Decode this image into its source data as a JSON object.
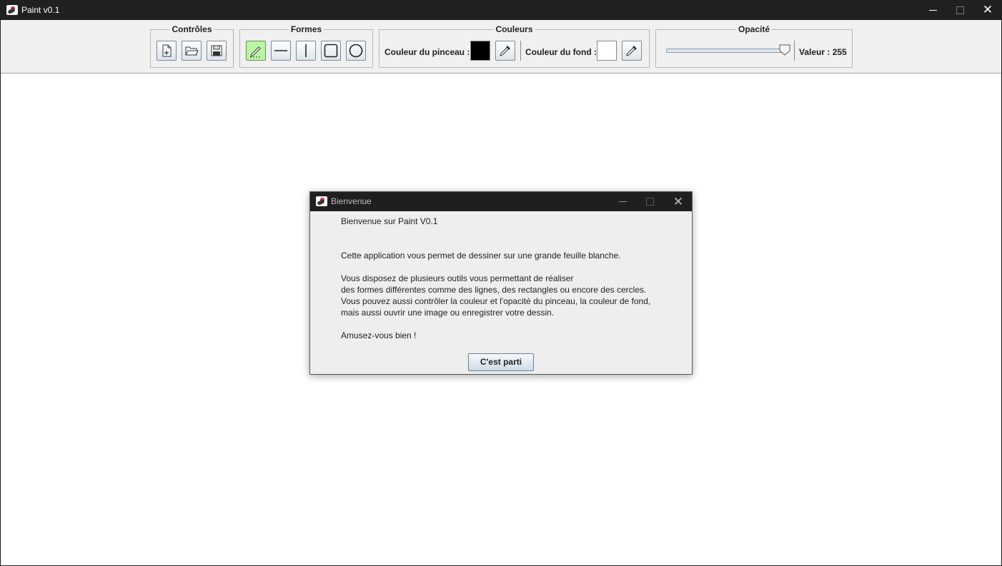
{
  "window": {
    "title": "Paint v0.1",
    "icon": "paint-app-icon",
    "controls": {
      "minimize": "minimize-icon",
      "maximize": "maximize-icon",
      "close": "✕"
    }
  },
  "toolbar": {
    "controles": {
      "legend": "Contrôles",
      "buttons": [
        {
          "name": "new-document",
          "icon": "new-document-icon"
        },
        {
          "name": "open-folder",
          "icon": "open-folder-icon"
        },
        {
          "name": "save",
          "icon": "save-icon"
        }
      ]
    },
    "formes": {
      "legend": "Formes",
      "selected": "pencil",
      "buttons": [
        {
          "name": "pencil",
          "icon": "pencil-icon",
          "active": true
        },
        {
          "name": "horizontal-line",
          "icon": "horizontal-line-icon"
        },
        {
          "name": "vertical-line",
          "icon": "vertical-line-icon"
        },
        {
          "name": "rectangle",
          "icon": "rectangle-icon"
        },
        {
          "name": "circle",
          "icon": "circle-icon"
        }
      ]
    },
    "couleurs": {
      "legend": "Couleurs",
      "brush_label": "Couleur du pinceau :",
      "brush_color": "#000000",
      "background_label": "Couleur du fond :",
      "background_color": "#ffffff",
      "picker_icon": "eyedropper-icon",
      "active_tool_color": "#b9f5a3"
    },
    "opacite": {
      "legend": "Opacité",
      "value_label": "Valeur : 255",
      "slider_value": 255,
      "slider_max": 255
    }
  },
  "dialog": {
    "title": "Bienvenue",
    "lines": {
      "l1": "Bienvenue sur Paint V0.1",
      "l2": "Cette application vous permet de dessiner sur une grande feuille blanche.",
      "l3": "Vous disposez de plusieurs outils vous permettant de réaliser",
      "l4": "des formes différentes comme des lignes, des rectangles ou encore des cercles.",
      "l5": "Vous pouvez aussi contrôler la couleur et l'opacité du pinceau, la couleur de fond,",
      "l6": "mais aussi ouvrir une image ou enregistrer votre dessin.",
      "l7": "Amusez-vous bien !"
    },
    "ok_label": "C'est parti"
  }
}
